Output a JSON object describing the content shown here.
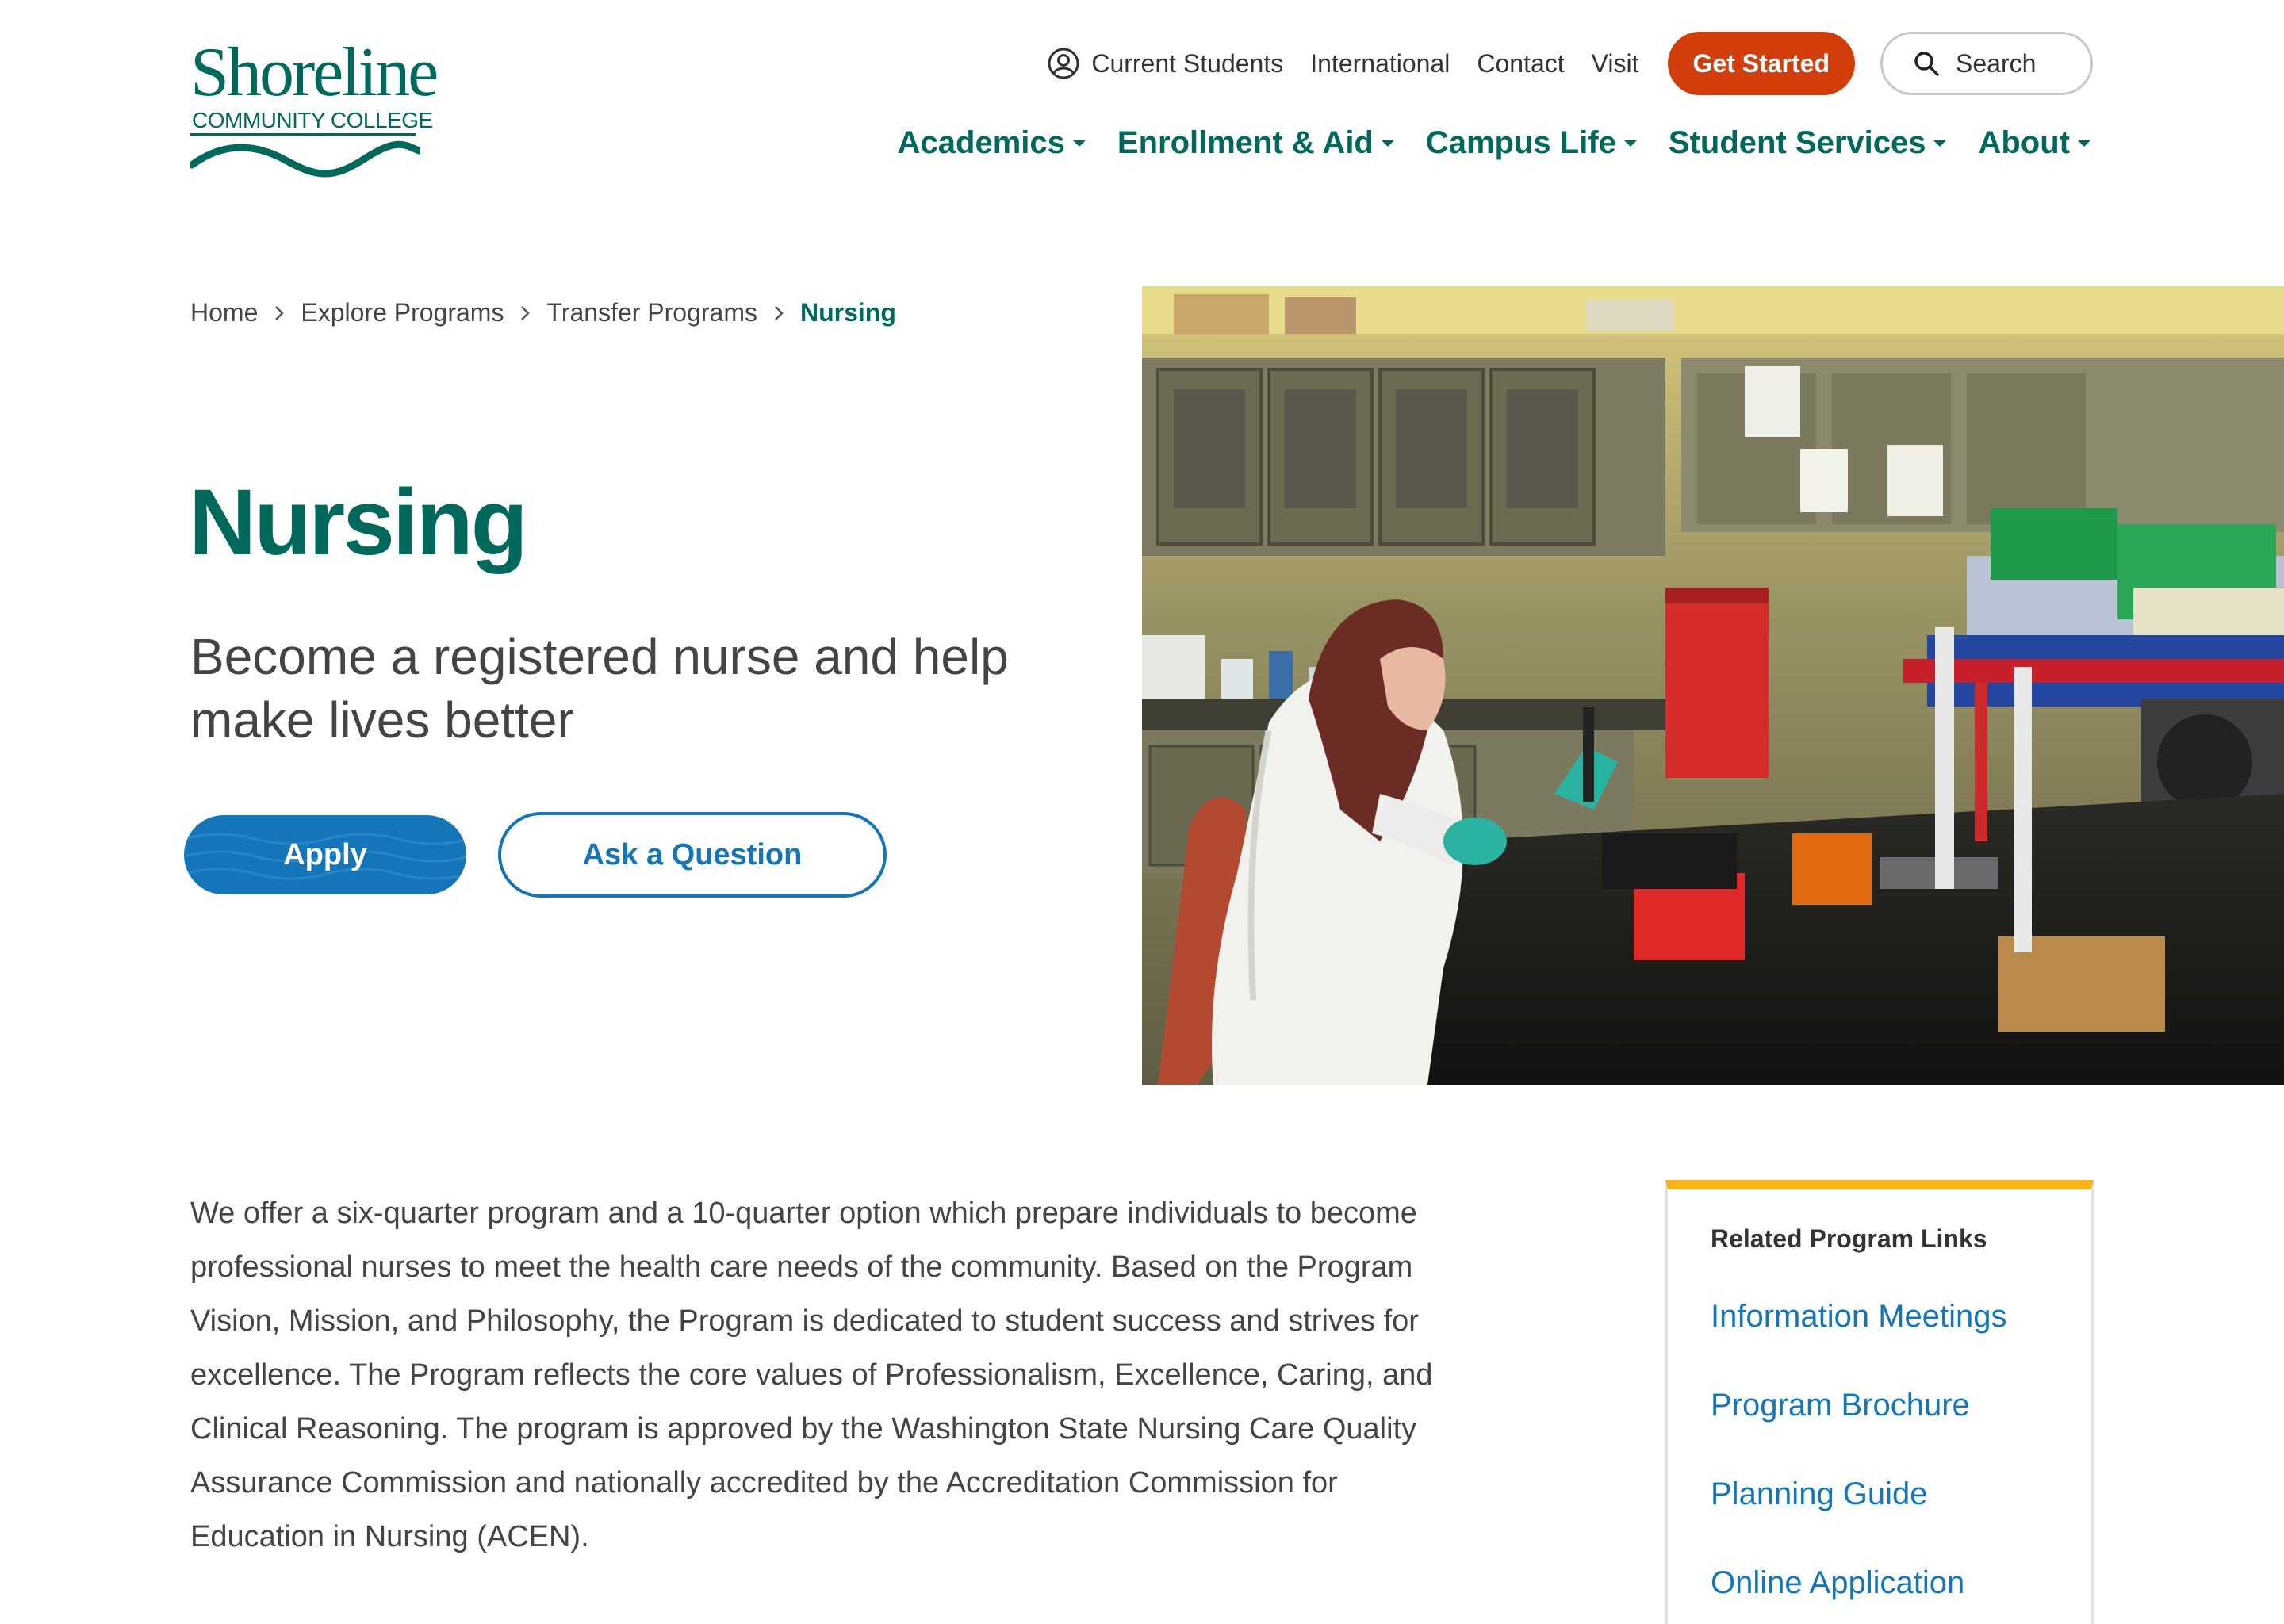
{
  "brand": {
    "logo_word": "Shoreline",
    "logo_sub": "COMMUNITY COLLEGE"
  },
  "utility_nav": {
    "current_students": "Current Students",
    "international": "International",
    "contact": "Contact",
    "visit": "Visit",
    "get_started": "Get Started",
    "search_placeholder": "Search"
  },
  "main_nav": {
    "items": [
      {
        "label": "Academics"
      },
      {
        "label": "Enrollment & Aid"
      },
      {
        "label": "Campus Life"
      },
      {
        "label": "Student Services"
      },
      {
        "label": "About"
      }
    ]
  },
  "breadcrumb": {
    "items": [
      {
        "label": "Home"
      },
      {
        "label": "Explore Programs"
      },
      {
        "label": "Transfer Programs"
      },
      {
        "label": "Nursing"
      }
    ]
  },
  "hero": {
    "title": "Nursing",
    "tagline": "Become a registered nurse and help make lives better",
    "apply_label": "Apply",
    "ask_label": "Ask a Question"
  },
  "intro_text": "We offer a six-quarter program and a 10-quarter option which prepare individuals to become professional nurses to meet the health care needs of the community. Based on the Program Vision, Mission, and Philosophy, the Program is dedicated to student success and strives for excellence. The Program reflects the core values of Professionalism, Excellence, Caring, and Clinical Reasoning. The program is approved by the Washington State Nursing Care Quality Assurance Commission and nationally accredited by the Accreditation Commission for Education in Nursing (ACEN).",
  "related": {
    "title": "Related Program Links",
    "links": [
      {
        "label": "Information Meetings"
      },
      {
        "label": "Program Brochure"
      },
      {
        "label": "Planning Guide"
      },
      {
        "label": "Online Application"
      }
    ]
  },
  "colors": {
    "brand_green": "#00695c",
    "accent_orange": "#d13e0c",
    "link_blue": "#1476b8",
    "highlight_yellow": "#f7b51c"
  },
  "icons": {
    "user": "user-circle-icon",
    "search": "search-icon",
    "caret": "caret-down-icon",
    "chevron": "chevron-right-icon"
  }
}
